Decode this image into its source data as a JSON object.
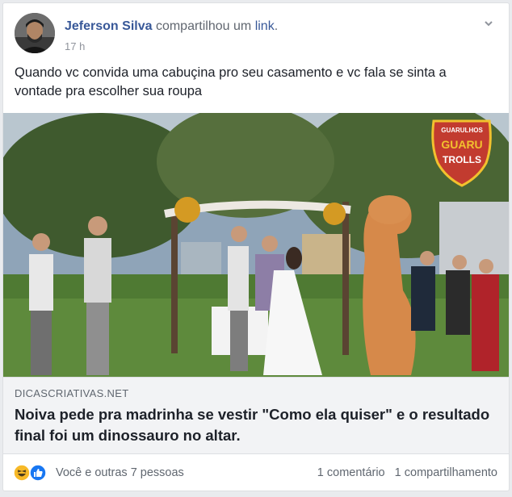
{
  "post": {
    "author": "Jeferson Silva",
    "action_verb": "compartilhou um",
    "action_link": "link",
    "action_end": ".",
    "timestamp": "17 h",
    "text": "Quando vc convida uma cabuçina pro seu casamento e vc fala se sinta a vontade pra escolher sua roupa"
  },
  "photo": {
    "watermark_top": "GUARULHOS",
    "watermark_main1": "GUARU",
    "watermark_main2": "TROLLS"
  },
  "link_preview": {
    "domain": "DICASCRIATIVAS.NET",
    "title": "Noiva pede pra madrinha se vestir \"Como ela quiser\" e o resultado final foi um dinossauro no altar."
  },
  "footer": {
    "reactions_text": "Você e outras 7 pessoas",
    "comments": "1 comentário",
    "shares": "1 compartilhamento"
  },
  "colors": {
    "link": "#385898",
    "secondary_text": "#606770",
    "like_blue": "#1877f2",
    "haha_yellow": "#f7b928"
  },
  "icons": [
    "chevron-down-icon",
    "haha-reaction-icon",
    "like-reaction-icon"
  ]
}
